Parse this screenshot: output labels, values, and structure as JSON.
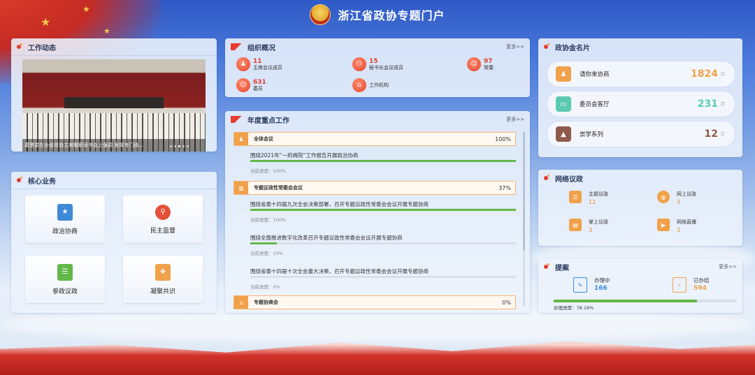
{
  "header": {
    "title": "浙江省政协专题门户"
  },
  "news": {
    "title": "工作动态",
    "caption": "葛慧君在全省政协主席履职读书会上强调 发挥专门协...",
    "dots": 5,
    "active_dot": 3
  },
  "core": {
    "title": "核心业务",
    "items": [
      {
        "label": "政治协商",
        "icon": "document-star-icon"
      },
      {
        "label": "民主监督",
        "icon": "person-search-icon"
      },
      {
        "label": "参政议政",
        "icon": "checklist-icon"
      },
      {
        "label": "凝聚共识",
        "icon": "book-icon"
      }
    ]
  },
  "org": {
    "title": "组织概况",
    "more": "更多>>",
    "items": [
      {
        "num": "11",
        "label": "主席会议成员"
      },
      {
        "num": "15",
        "label": "秘书长会议成员"
      },
      {
        "num": "97",
        "label": "常委"
      },
      {
        "num": "631",
        "label": "委员"
      },
      {
        "num": "",
        "label": "工作机构"
      }
    ]
  },
  "annual": {
    "title": "年度重点工作",
    "more": "更多>>",
    "categories": [
      {
        "label": "全体会议",
        "pct": "100%",
        "tasks": [
          {
            "title": "围绕2021年“一府两院”工作报告开展政治协商",
            "progress_text": "当前进度：100%",
            "progress": 100
          }
        ]
      },
      {
        "label": "专题议政性常委会会议",
        "pct": "37%",
        "tasks": [
          {
            "title": "围绕省委十四届九次全会决策部署，召开专题议政性常委会会议开展专题协商",
            "progress_text": "当前进度：100%",
            "progress": 100
          },
          {
            "title": "围绕全面推进数字化改革召开专题议政性常委会会议开展专题协商",
            "progress_text": "当前进度：10%",
            "progress": 10
          },
          {
            "title": "围绕省委十四届十次全会重大决策，召开专题议政性常委会会议开展专题协商",
            "progress_text": "当前进度：0%",
            "progress": 0
          }
        ]
      },
      {
        "label": "专题协商会",
        "pct": "0%",
        "tasks": []
      }
    ]
  },
  "golden": {
    "title": "政协金名片",
    "items": [
      {
        "label": "请你来协商",
        "value": "1824",
        "unit": "次",
        "color": "#f0a14a"
      },
      {
        "label": "委员会客厅",
        "value": "231",
        "unit": "次",
        "color": "#5ccab0"
      },
      {
        "label": "崇学系列",
        "value": "12",
        "unit": "次",
        "color": "#8f5a4a"
      }
    ]
  },
  "network": {
    "title": "网络议政",
    "items": [
      {
        "label": "主题议政",
        "value": "12"
      },
      {
        "label": "网上议政",
        "value": "3"
      },
      {
        "label": "掌上议政",
        "value": "3"
      },
      {
        "label": "网络直播",
        "value": "3"
      }
    ]
  },
  "proposal": {
    "title": "提案",
    "more": "更多>>",
    "processing_label": "办理中",
    "processing_value": "166",
    "done_label": "已办结",
    "done_value": "594",
    "rate_text": "办理进度：78.16%",
    "rate": 78.16
  },
  "colors": {
    "accent_red": "#e53c2f",
    "accent_orange": "#f0a14a",
    "progress_green": "#62b849",
    "proposal_blue": "#3f8ad8"
  }
}
